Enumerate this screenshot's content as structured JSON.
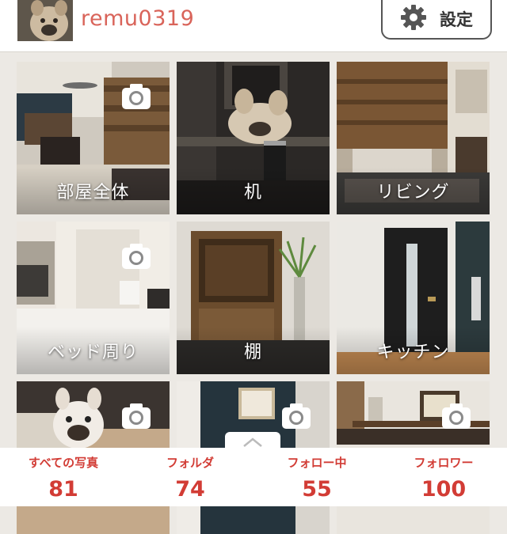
{
  "header": {
    "username": "remu0319",
    "settings_label": "設定",
    "avatar_alt": "profile-photo"
  },
  "folders": [
    {
      "label": "部屋全体"
    },
    {
      "label": "机"
    },
    {
      "label": "リビング"
    },
    {
      "label": "ベッド周り"
    },
    {
      "label": "棚"
    },
    {
      "label": "キッチン"
    },
    {
      "label": ""
    },
    {
      "label": ""
    },
    {
      "label": ""
    }
  ],
  "stats": [
    {
      "label": "すべての写真",
      "value": "81"
    },
    {
      "label": "フォルダ",
      "value": "74"
    },
    {
      "label": "フォロー中",
      "value": "55"
    },
    {
      "label": "フォロワー",
      "value": "100"
    }
  ],
  "colors": {
    "accent": "#d23c35",
    "username": "#d9645a"
  }
}
